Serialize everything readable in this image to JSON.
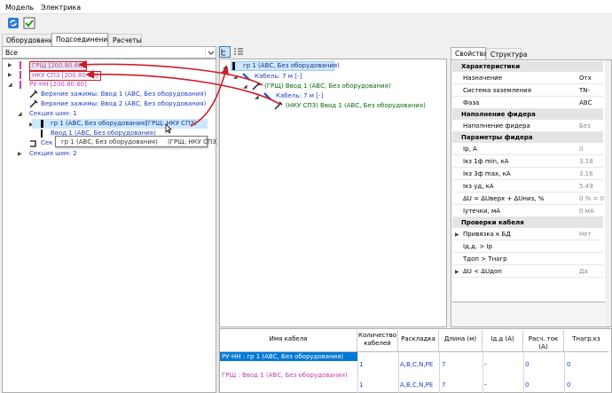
{
  "menu": [
    "Модель",
    "Электрика"
  ],
  "tabs": [
    "Оборудование",
    "Подсоединения",
    "Расчеты"
  ],
  "filter": {
    "value": "Все"
  },
  "left_tree": {
    "items": [
      {
        "label": "ГРЩ [200.80.60]"
      },
      {
        "label": "НКУ СПЗ [200.80.60]"
      },
      {
        "label": "РУ-НН [200.80.60]"
      },
      {
        "label": "Верхние зажимы: Ввод 1 (АВС, Без оборудования)"
      },
      {
        "label": "Верхние зажимы: Ввод 2 (АВС, Без оборудования)"
      },
      {
        "label": "Секция шин: 1"
      },
      {
        "label": "гр 1 (АВС, Без оборудования)"
      },
      {
        "label": "(ГРЩ: НКУ СПЗ)"
      },
      {
        "label": "Ввод 1 (АВС, Без оборудования)"
      },
      {
        "label": "Сек 1"
      },
      {
        "label": "Секция шин: 2"
      }
    ],
    "tooltip": "гр 1 (АВС, Без оборудования)     (ГРЩ: НКУ СПЗ)"
  },
  "mid_tree": {
    "items": [
      {
        "label": "гр 1 (АВС, Без оборудования)"
      },
      {
        "label": "Кабель: 7 м [-]"
      },
      {
        "label": "(ГРЩ) Ввод 1 (АВС, Без оборудования)"
      },
      {
        "label": "Кабель: 7 м [-]"
      },
      {
        "label": "(НКУ СПЗ) Ввод 1 (АВС, Без оборудования)"
      }
    ]
  },
  "right_tabs": [
    "Свойства",
    "Структура"
  ],
  "props": {
    "sections": {
      "s1": "Характеристики",
      "s2": "Наполнение фидера",
      "s3": "Параметры фидера",
      "s4": "Проверки кабеля"
    },
    "rows": {
      "naznach": {
        "k": "Назначение",
        "v": "Отх"
      },
      "zazem": {
        "k": "Система заземления",
        "v": "TN-"
      },
      "faza": {
        "k": "Фаза",
        "v": "АВС"
      },
      "napoln": {
        "k": "Наполнение фидера",
        "v": "Без"
      },
      "ip": {
        "k": "Ip, А",
        "v": "0"
      },
      "ikz1": {
        "k": "Iкз 1ф min, кА",
        "v": "3.18"
      },
      "ikz3": {
        "k": "Iкз 3ф max, кА",
        "v": "3.16"
      },
      "ikzud": {
        "k": "Iкз уд, кА",
        "v": "5.49"
      },
      "du": {
        "k": "ΔU = ΔUверх + ΔUниз, %",
        "v": "0 % = 0"
      },
      "iut": {
        "k": "Iутечки, мА",
        "v": "0 мА"
      },
      "privyazka": {
        "k": "Привязка к БД",
        "v": "Нет"
      },
      "idd": {
        "k": "Iд.д. > Ip",
        "v": ""
      },
      "tdop": {
        "k": "Tдоп > Tнагр",
        "v": ""
      },
      "dudop": {
        "k": "ΔU < ΔUдоп",
        "v": "Да"
      }
    }
  },
  "table": {
    "headers": {
      "name": "Имя кабеля",
      "count": "Количество кабелей",
      "rask": "Раскладка",
      "len": "Длина (м)",
      "idd": "Iд.д (А)",
      "rasch": "Расч. ток (А)",
      "tnagr": "Tнагр.кз"
    },
    "rows": [
      {
        "name": "РУ-НН : гр 1 (АВС, Без оборудования)",
        "count": "1",
        "rask": "A,B,C,N,PE",
        "len": "7",
        "idd": "-",
        "rasch": "0",
        "tnagr": "0"
      },
      {
        "name": "ГРЩ : Ввод 1 (АВС, Без оборудования)",
        "count": "1",
        "rask": "A,B,C,N,PE",
        "len": "7",
        "idd": "-",
        "rasch": "0",
        "tnagr": "0"
      }
    ]
  },
  "colors": {
    "selection": "#cce8ff",
    "arrow": "#cc1e2a",
    "row_selected": "#0078d7"
  }
}
